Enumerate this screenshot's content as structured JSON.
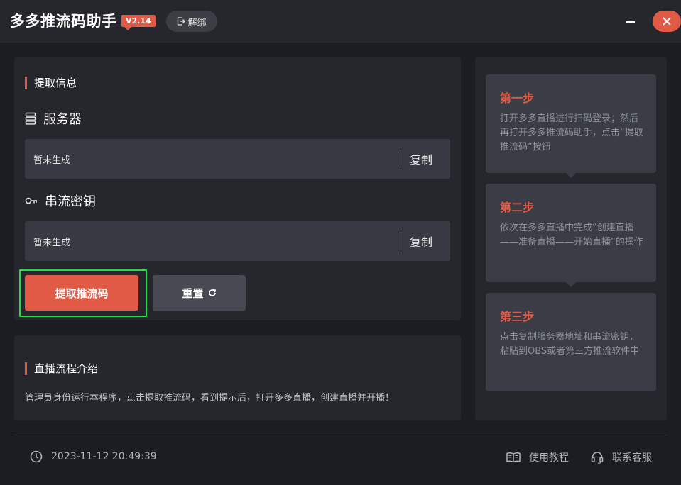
{
  "app": {
    "title": "多多推流码助手",
    "version": "V2.14",
    "unbind_label": "解绑"
  },
  "extract": {
    "section_title": "提取信息",
    "server": {
      "label": "服务器",
      "value": "暂未生成",
      "copy_label": "复制",
      "icon": "server-icon"
    },
    "stream_key": {
      "label": "串流密钥",
      "value": "暂未生成",
      "copy_label": "复制",
      "icon": "key-icon"
    },
    "extract_button": "提取推流码",
    "reset_button": "重置"
  },
  "intro": {
    "title": "直播流程介绍",
    "text": "管理员身份运行本程序，点击提取推流码，看到提示后，打开多多直播，创建直播并开播！"
  },
  "steps": [
    {
      "title": "第一步",
      "text": "打开多多直播进行扫码登录；然后再打开多多推流码助手，点击“提取推流码”按钮"
    },
    {
      "title": "第二步",
      "text": "依次在多多直播中完成“创建直播——准备直播——开始直播”的操作"
    },
    {
      "title": "第三步",
      "text": "点击复制服务器地址和串流密钥，粘贴到OBS或者第三方推流软件中"
    }
  ],
  "footer": {
    "datetime": "2023-11-12 20:49:39",
    "tutorial_label": "使用教程",
    "support_label": "联系客服"
  },
  "colors": {
    "accent": "#e05a45",
    "background": "#1b1d22",
    "panel": "#25272d",
    "field": "#373a42",
    "focus_ring": "#22e04a"
  }
}
